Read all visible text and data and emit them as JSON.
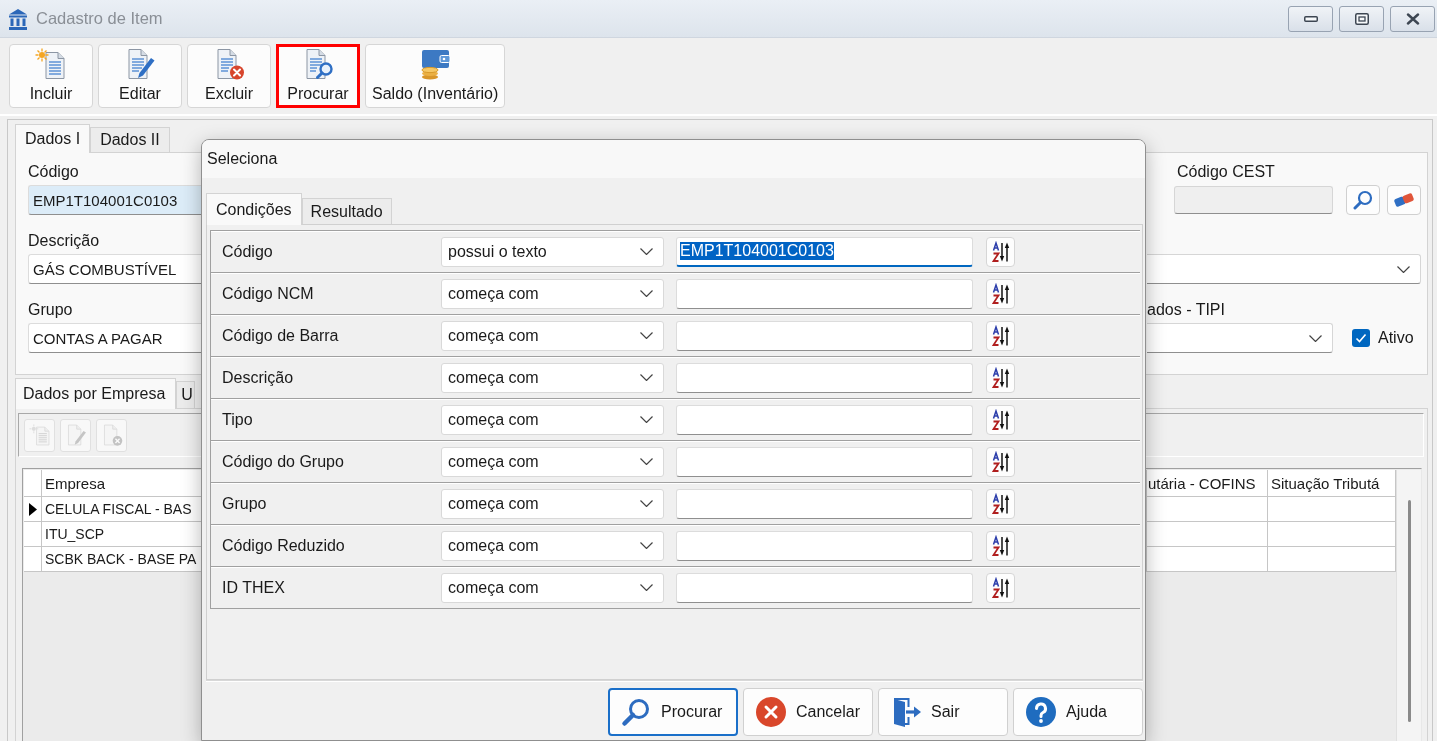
{
  "window": {
    "title": "Cadastro de Item"
  },
  "toolbar": [
    {
      "label": "Incluir",
      "kind": "add",
      "highlighted": false
    },
    {
      "label": "Editar",
      "kind": "edit",
      "highlighted": false
    },
    {
      "label": "Excluir",
      "kind": "delete",
      "highlighted": false
    },
    {
      "label": "Procurar",
      "kind": "search",
      "highlighted": true
    },
    {
      "label": "Saldo (Inventário)",
      "kind": "balance",
      "highlighted": false
    }
  ],
  "form_tabs": [
    {
      "label": "Dados I",
      "selected": true
    },
    {
      "label": "Dados II",
      "selected": false
    }
  ],
  "form": {
    "left_fields": [
      {
        "label": "Código",
        "value": "EMP1T104001C0103",
        "focused": true
      },
      {
        "label": "Descrição",
        "value": "GÁS COMBUSTÍVEL",
        "focused": false
      },
      {
        "label": "Grupo",
        "value": "CONTAS A PAGAR",
        "focused": false
      }
    ],
    "right_fields": [
      {
        "kind": "lookup",
        "label": "Código CEST",
        "disabled": true
      },
      {
        "kind": "dropdown"
      },
      {
        "kind": "dropdown",
        "label": "ados - TIPI",
        "checkbox": {
          "label": "Ativo",
          "checked": true
        }
      }
    ]
  },
  "detail_tabs": [
    {
      "label": "Dados por Empresa",
      "selected": true
    },
    {
      "label": "U",
      "selected": false
    }
  ],
  "detail_toolbar": [
    {
      "kind": "add",
      "disabled": true
    },
    {
      "kind": "edit",
      "disabled": true
    },
    {
      "kind": "delete",
      "disabled": true
    }
  ],
  "grid": {
    "columns": [
      "Empresa",
      "utária - COFINS",
      "Situação Tributá"
    ],
    "rows": [
      {
        "current": true,
        "empresa": "CELULA FISCAL - BAS"
      },
      {
        "current": false,
        "empresa": "ITU_SCP"
      },
      {
        "current": false,
        "empresa": "SCBK BACK - BASE PA"
      }
    ]
  },
  "dialog": {
    "title": "Seleciona",
    "tabs": [
      {
        "label": "Condições",
        "selected": true
      },
      {
        "label": "Resultado",
        "selected": false
      }
    ],
    "conditions": [
      {
        "field": "Código",
        "operator": "possui o texto",
        "value": "EMP1T104001C0103",
        "focused": true
      },
      {
        "field": "Código NCM",
        "operator": "começa com",
        "focused": false
      },
      {
        "field": "Código de Barra",
        "operator": "começa com",
        "focused": false
      },
      {
        "field": "Descrição",
        "operator": "começa com",
        "focused": false
      },
      {
        "field": "Tipo",
        "operator": "começa com",
        "focused": false
      },
      {
        "field": "Código do Grupo",
        "operator": "começa com",
        "focused": false
      },
      {
        "field": "Grupo",
        "operator": "começa com",
        "focused": false
      },
      {
        "field": "Código Reduzido",
        "operator": "começa com",
        "focused": false
      },
      {
        "field": "ID THEX",
        "operator": "começa com",
        "focused": false
      }
    ],
    "buttons": [
      {
        "label": "Procurar",
        "kind": "search",
        "focused": true
      },
      {
        "label": "Cancelar",
        "kind": "cancel",
        "focused": false
      },
      {
        "label": "Sair",
        "kind": "exit",
        "focused": false
      },
      {
        "label": "Ajuda",
        "kind": "help",
        "focused": false
      }
    ]
  }
}
